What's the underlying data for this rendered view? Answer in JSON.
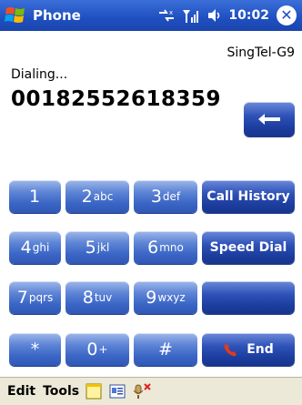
{
  "window": {
    "title": "Phone",
    "time": "10:02",
    "icons": [
      "windows-start-icon",
      "connectivity-icon",
      "signal-icon",
      "volume-icon",
      "close-icon"
    ]
  },
  "carrier": "SingTel-G9",
  "status_text": "Dialing...",
  "dialed_number": "00182552618359",
  "keypad": {
    "backspace": "backspace-arrow-icon",
    "keys": [
      {
        "main": "1",
        "sub": ""
      },
      {
        "main": "2",
        "sub": "abc"
      },
      {
        "main": "3",
        "sub": "def"
      },
      {
        "main": "4",
        "sub": "ghi"
      },
      {
        "main": "5",
        "sub": "jkl"
      },
      {
        "main": "6",
        "sub": "mno"
      },
      {
        "main": "7",
        "sub": "pqrs"
      },
      {
        "main": "8",
        "sub": "tuv"
      },
      {
        "main": "9",
        "sub": "wxyz"
      },
      {
        "main": "*",
        "sub": ""
      },
      {
        "main": "0",
        "sub": "+"
      },
      {
        "main": "#",
        "sub": ""
      }
    ],
    "call_history": "Call History",
    "speed_dial": "Speed Dial",
    "end": "End"
  },
  "bottom_bar": {
    "edit": "Edit",
    "tools": "Tools",
    "icons": [
      "note-icon",
      "contact-card-icon",
      "mute-microphone-icon"
    ]
  },
  "colors": {
    "titlebar": "#1f4fc0",
    "button": "#3b66c6",
    "end_icon": "#e23a1b"
  }
}
